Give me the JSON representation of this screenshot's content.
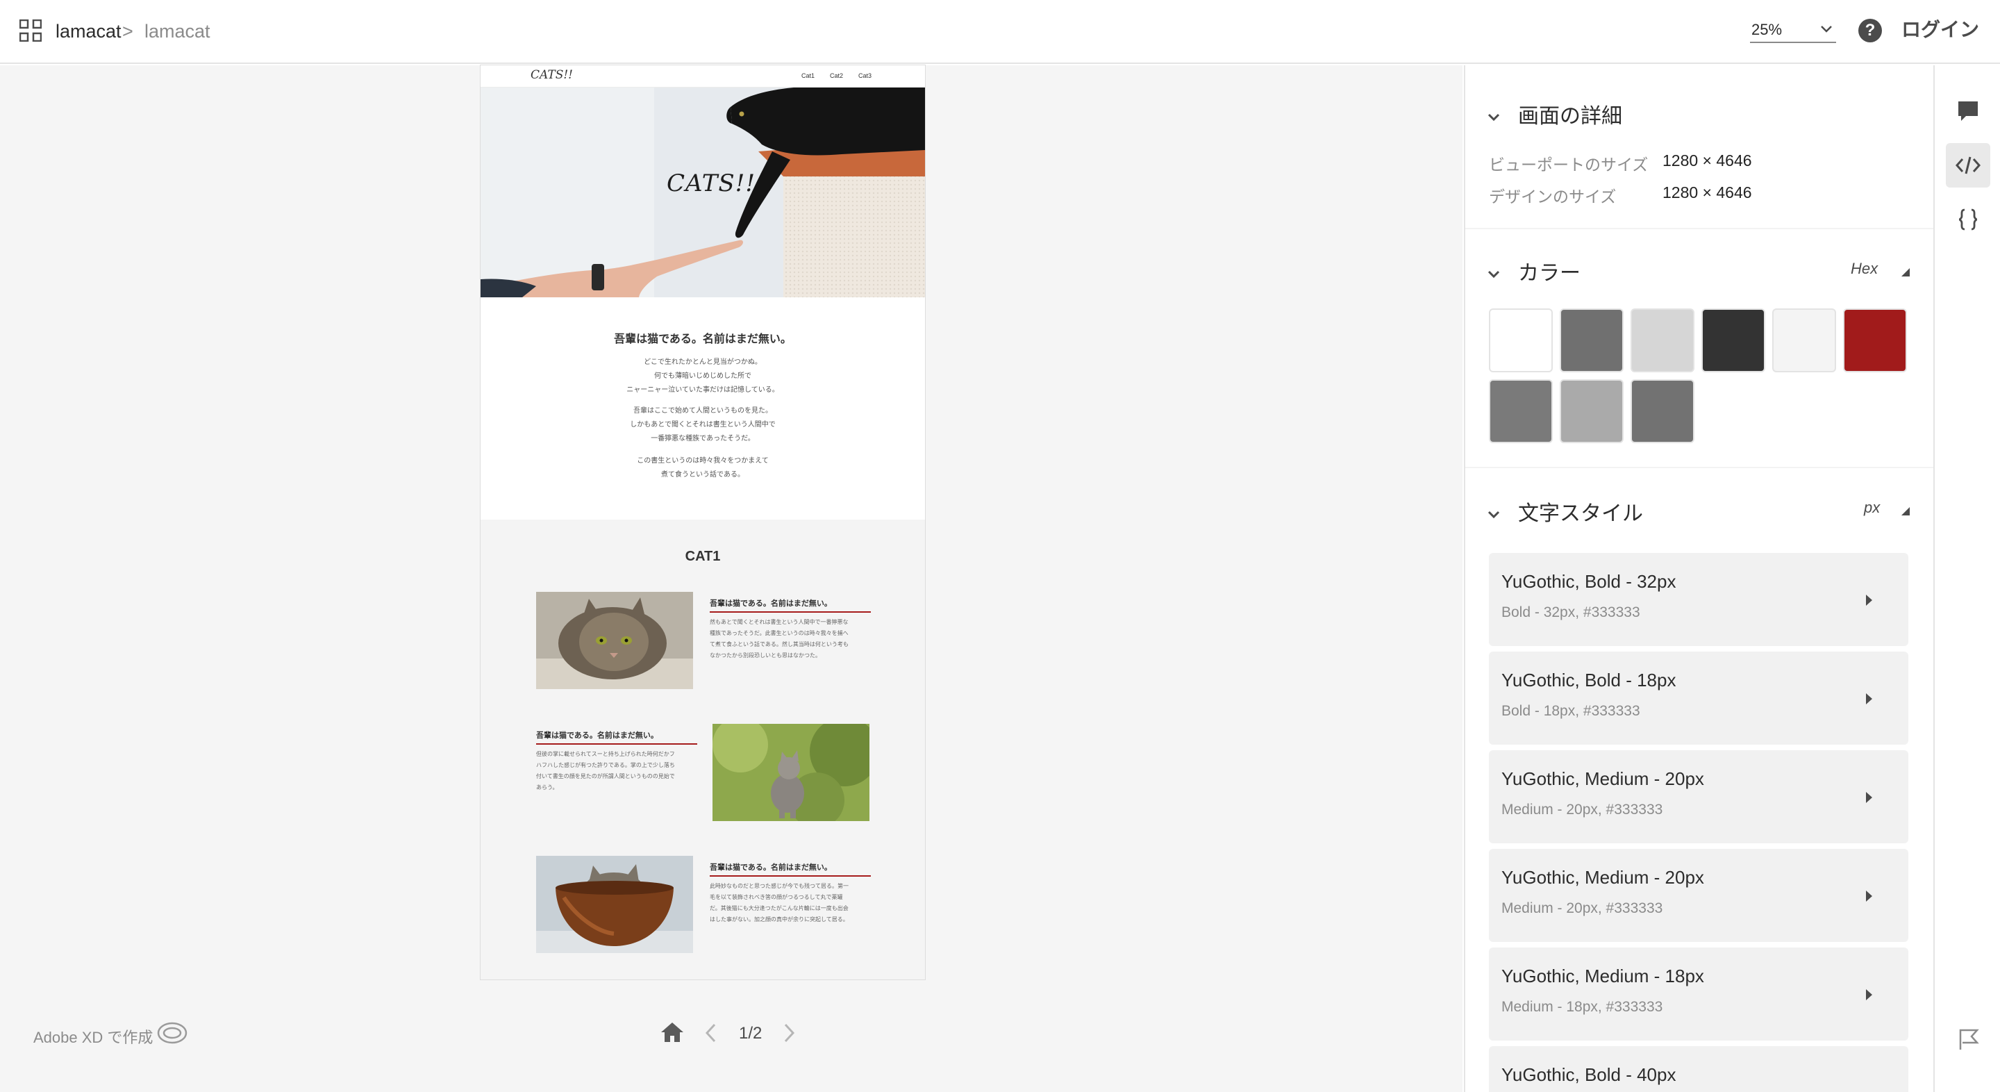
{
  "breadcrumb": {
    "project": "lamacat",
    "separator": ">",
    "current": "lamacat"
  },
  "header": {
    "zoom": "25%",
    "help": "?",
    "login": "ログイン"
  },
  "artboard": {
    "logo": "CATS!!",
    "nav": [
      "Cat1",
      "Cat2",
      "Cat3"
    ],
    "hero_title": "CATS!!",
    "intro_heading": "吾輩は猫である。名前はまだ無い。",
    "intro_paragraphs": [
      [
        "どこで生れたかとんと見当がつかぬ。",
        "何でも薄暗いじめじめした所で",
        "ニャーニャー泣いていた事だけは記憶している。"
      ],
      [
        "吾輩はここで始めて人間というものを見た。",
        "しかもあとで聞くとそれは書生という人間中で",
        "一番獰悪な種族であったそうだ。"
      ],
      [
        "この書生というのは時々我々をつかまえて",
        "煮て食うという話である。"
      ]
    ],
    "section_title": "CAT1",
    "cards": [
      {
        "heading": "吾輩は猫である。名前はまだ無い。",
        "text": [
          "然もあとで聞くとそれは書生という人間中で一番獰悪な",
          "種族であったそうだ。此書生というのは時々我々を捕へ",
          "て煮て食ふという話である。然し其当時は何という考も",
          "なかつたから別段恐しいとも思はなかつた。"
        ]
      },
      {
        "heading": "吾輩は猫である。名前はまだ無い。",
        "text": [
          "但彼の掌に載せられてスーと持ち上げられた時何だかフ",
          "ハフハした感じが有つた許りである。掌の上で少し落ち",
          "付いて書生の顔を見たのが所謂人間というものの見始で",
          "あらう。"
        ]
      },
      {
        "heading": "吾輩は猫である。名前はまだ無い。",
        "text": [
          "此時妙なものだと思つた感じが今でも残つて居る。第一",
          "毛を以て装飾されべき筈の顔がつるつるして丸で薬罐",
          "だ。其後猫にも大分逢つたがこんな片輪には一度も出会",
          "はした事がない。加之顔の真中が余りに突起して居る。"
        ]
      }
    ]
  },
  "footer": {
    "made_with": "Adobe XD で作成",
    "page": "1/2"
  },
  "panel": {
    "details": {
      "title": "画面の詳細",
      "rows": [
        {
          "label": "ビューポートのサイズ",
          "value": "1280 × 4646"
        },
        {
          "label": "デザインのサイズ",
          "value": "1280 × 4646"
        }
      ]
    },
    "colors": {
      "title": "カラー",
      "format": "Hex",
      "swatches": [
        "#ffffff",
        "#707070",
        "#d6d6d6",
        "#333333",
        "#f4f4f4",
        "#a11b1b",
        "#7a7a7a",
        "#aaaaaa",
        "#727272"
      ]
    },
    "text_styles": {
      "title": "文字スタイル",
      "unit": "px",
      "items": [
        {
          "name": "YuGothic, Bold - 32px",
          "detail": "Bold - 32px, #333333"
        },
        {
          "name": "YuGothic, Bold - 18px",
          "detail": "Bold - 18px, #333333"
        },
        {
          "name": "YuGothic, Medium - 20px",
          "detail": "Medium - 20px, #333333"
        },
        {
          "name": "YuGothic, Medium - 20px",
          "detail": "Medium - 20px, #333333"
        },
        {
          "name": "YuGothic, Medium - 18px",
          "detail": "Medium - 18px, #333333"
        },
        {
          "name": "YuGothic, Bold - 40px",
          "detail": ""
        }
      ]
    }
  },
  "rail": {
    "icons": [
      "comment-icon",
      "code-icon",
      "braces-icon",
      "flag-icon"
    ],
    "accent": "#4b4b4b"
  }
}
